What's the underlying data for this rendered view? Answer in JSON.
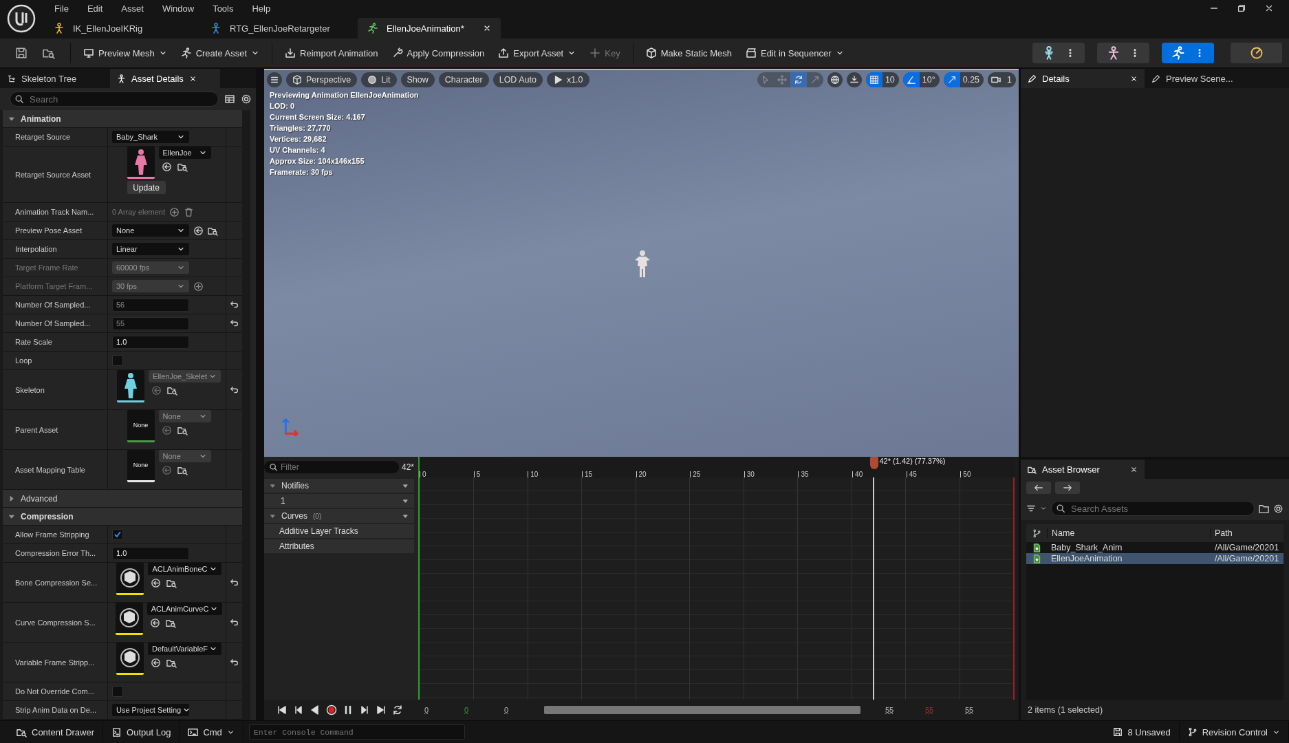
{
  "app_menu": [
    "File",
    "Edit",
    "Asset",
    "Window",
    "Tools",
    "Help"
  ],
  "document_tabs": [
    {
      "label": "IK_EllenJoeIKRig",
      "kind": "ikrig",
      "selected": false
    },
    {
      "label": "RTG_EllenJoeRetargeter",
      "kind": "retargeter",
      "selected": false
    },
    {
      "label": "EllenJoeAnimation*",
      "kind": "animation",
      "selected": true
    }
  ],
  "toolbar": [
    {
      "label": "Preview Mesh",
      "kind": "mesh",
      "dropdown": true,
      "disabled": false
    },
    {
      "label": "Create Asset",
      "kind": "create",
      "dropdown": true,
      "disabled": false
    },
    {
      "label": "Reimport Animation",
      "kind": "reimport",
      "dropdown": false,
      "disabled": false
    },
    {
      "label": "Apply Compression",
      "kind": "compress",
      "dropdown": false,
      "disabled": false
    },
    {
      "label": "Export Asset",
      "kind": "export",
      "dropdown": true,
      "disabled": false
    },
    {
      "label": "Key",
      "kind": "key",
      "dropdown": false,
      "disabled": true
    },
    {
      "label": "Make Static Mesh",
      "kind": "static",
      "dropdown": false,
      "disabled": false
    },
    {
      "label": "Edit in Sequencer",
      "kind": "sequencer",
      "dropdown": true,
      "disabled": false
    }
  ],
  "mode_buttons": [
    {
      "kind": "skeleton",
      "selected": false
    },
    {
      "kind": "mesh",
      "selected": false
    },
    {
      "kind": "animation",
      "selected": true
    },
    {
      "kind": "physics",
      "selected": false
    }
  ],
  "left_panel": {
    "tabs": [
      {
        "label": "Skeleton Tree",
        "selected": false
      },
      {
        "label": "Asset Details",
        "selected": true
      }
    ],
    "search": {
      "placeholder": "Search"
    },
    "sections": [
      {
        "title": "Animation",
        "expanded": true,
        "rows": [
          {
            "kind": "combo",
            "label": "Retarget Source",
            "value": "Baby_Shark",
            "disabled": false
          },
          {
            "kind": "asset",
            "label": "Retarget Source Asset",
            "value": "EllenJoe",
            "thumbnail": {
              "kind": "figure",
              "color": "#e878a8"
            },
            "button": "Update",
            "disabled": false
          },
          {
            "kind": "array",
            "label": "Animation Track Nam...",
            "value": "0 Array element"
          },
          {
            "kind": "combo",
            "label": "Preview Pose Asset",
            "value": "None",
            "disabled": false,
            "browse": true
          },
          {
            "kind": "combo",
            "label": "Interpolation",
            "value": "Linear",
            "disabled": false
          },
          {
            "kind": "combo",
            "label": "Target Frame Rate",
            "value": "60000 fps",
            "disabled": true
          },
          {
            "kind": "combo",
            "label": "Platform Target Fram...",
            "value": "30 fps",
            "disabled": true,
            "add": true
          },
          {
            "kind": "number",
            "label": "Number Of Sampled...",
            "value": "56",
            "disabled": true,
            "reset": true
          },
          {
            "kind": "number",
            "label": "Number Of Sampled...",
            "value": "55",
            "disabled": true,
            "reset": true
          },
          {
            "kind": "number",
            "label": "Rate Scale",
            "value": "1.0",
            "disabled": false
          },
          {
            "kind": "checkbox",
            "label": "Loop",
            "checked": false
          },
          {
            "kind": "asset",
            "label": "Skeleton",
            "value": "EllenJoe_Skelet",
            "thumbnail": {
              "kind": "figure",
              "color": "#6fd0e0"
            },
            "disabled": true,
            "reset": true
          },
          {
            "kind": "asset",
            "label": "Parent Asset",
            "value": "None",
            "thumbnail": {
              "kind": "label",
              "text": "None",
              "color": "#4a9a4a"
            },
            "disabled": true
          },
          {
            "kind": "asset",
            "label": "Asset Mapping Table",
            "value": "None",
            "thumbnail": {
              "kind": "label",
              "text": "None",
              "color": "#e8e8e8"
            },
            "disabled": true
          }
        ]
      },
      {
        "title": "Advanced",
        "expanded": false
      },
      {
        "title": "Compression",
        "expanded": true,
        "rows": [
          {
            "kind": "checkbox",
            "label": "Allow Frame Stripping",
            "checked": true
          },
          {
            "kind": "number",
            "label": "Compression Error Th...",
            "value": "1.0",
            "disabled": false
          },
          {
            "kind": "asset",
            "label": "Bone Compression Se...",
            "value": "ACLAnimBoneC",
            "thumbnail": {
              "kind": "sphere",
              "color": "#f0e000"
            },
            "disabled": false,
            "reset": true
          },
          {
            "kind": "asset",
            "label": "Curve Compression S...",
            "value": "ACLAnimCurveC",
            "thumbnail": {
              "kind": "sphere",
              "color": "#f0e000"
            },
            "disabled": false,
            "reset": true
          },
          {
            "kind": "asset",
            "label": "Variable Frame Stripp...",
            "value": "DefaultVariableF",
            "thumbnail": {
              "kind": "sphere",
              "color": "#f0e000"
            },
            "disabled": false,
            "reset": true
          },
          {
            "kind": "checkbox",
            "label": "Do Not Override Com...",
            "checked": false
          },
          {
            "kind": "combo",
            "label": "Strip Anim Data on De...",
            "value": "Use Project Setting",
            "disabled": false
          }
        ]
      }
    ]
  },
  "viewport": {
    "toolbar": [
      {
        "label": "Perspective",
        "kind": "cube"
      },
      {
        "label": "Lit",
        "kind": "sphere"
      },
      {
        "label": "Show",
        "kind": "text"
      },
      {
        "label": "Character",
        "kind": "text"
      },
      {
        "label": "LOD Auto",
        "kind": "text"
      },
      {
        "label": "x1.0",
        "kind": "play"
      }
    ],
    "transform_tools": [
      {
        "kind": "select",
        "selected": false
      },
      {
        "kind": "move",
        "selected": false
      },
      {
        "kind": "rotate",
        "selected": true
      },
      {
        "kind": "scale",
        "selected": false
      }
    ],
    "snaps": [
      {
        "kind": "grid",
        "value": "10",
        "on": true
      },
      {
        "kind": "angle",
        "value": "10°",
        "on": true
      },
      {
        "kind": "scale",
        "value": "0.25",
        "on": true
      },
      {
        "kind": "camera",
        "value": "1",
        "on": false
      }
    ],
    "stats": [
      "Previewing Animation EllenJoeAnimation",
      "LOD: 0",
      "Current Screen Size: 4.167",
      "Triangles: 27,770",
      "Vertices: 29,682",
      "UV Channels: 4",
      "Approx Size: 104x146x155",
      "Framerate: 30 fps"
    ]
  },
  "timeline": {
    "filter": {
      "placeholder": "Filter"
    },
    "frame": "42*",
    "tracks": [
      {
        "kind": "header",
        "label": "Notifies"
      },
      {
        "kind": "sub",
        "label": "1"
      },
      {
        "kind": "header",
        "label": "Curves",
        "count": "(0)"
      },
      {
        "kind": "plain",
        "label": "Additive Layer Tracks"
      },
      {
        "kind": "plain",
        "label": "Attributes"
      }
    ],
    "ruler": [
      "0",
      "5",
      "10",
      "15",
      "20",
      "25",
      "30",
      "35",
      "40",
      "45",
      "50"
    ],
    "playhead": {
      "label": "42* (1.42) (77.37%)",
      "level": 0.7636
    },
    "readouts": [
      {
        "kind": "plain",
        "value": "0"
      },
      {
        "kind": "start",
        "value": "0"
      },
      {
        "kind": "plain",
        "value": "0"
      },
      {
        "kind": "plain",
        "value": "55"
      },
      {
        "kind": "end",
        "value": "55"
      },
      {
        "kind": "plain",
        "value": "55"
      }
    ]
  },
  "right_panel": {
    "tabs": [
      {
        "label": "Details",
        "selected": true
      },
      {
        "label": "Preview Scene...",
        "selected": false
      }
    ]
  },
  "asset_browser": {
    "title": "Asset Browser",
    "search": {
      "placeholder": "Search Assets"
    },
    "columns": [
      "Name",
      "Path"
    ],
    "rows": [
      {
        "name": "Baby_Shark_Anim",
        "path": "/All/Game/20201",
        "selected": false
      },
      {
        "name": "EllenJoeAnimation",
        "path": "/All/Game/20201",
        "selected": true
      }
    ],
    "footer": "2 items (1 selected)"
  },
  "status_bar": {
    "left": [
      {
        "kind": "drawer",
        "label": "Content Drawer"
      },
      {
        "kind": "log",
        "label": "Output Log"
      },
      {
        "kind": "cmd",
        "label": "Cmd"
      }
    ],
    "console": {
      "placeholder": "Enter Console Command"
    },
    "right": [
      {
        "kind": "save",
        "label": "8 Unsaved"
      },
      {
        "kind": "branch",
        "label": "Revision Control"
      }
    ]
  }
}
